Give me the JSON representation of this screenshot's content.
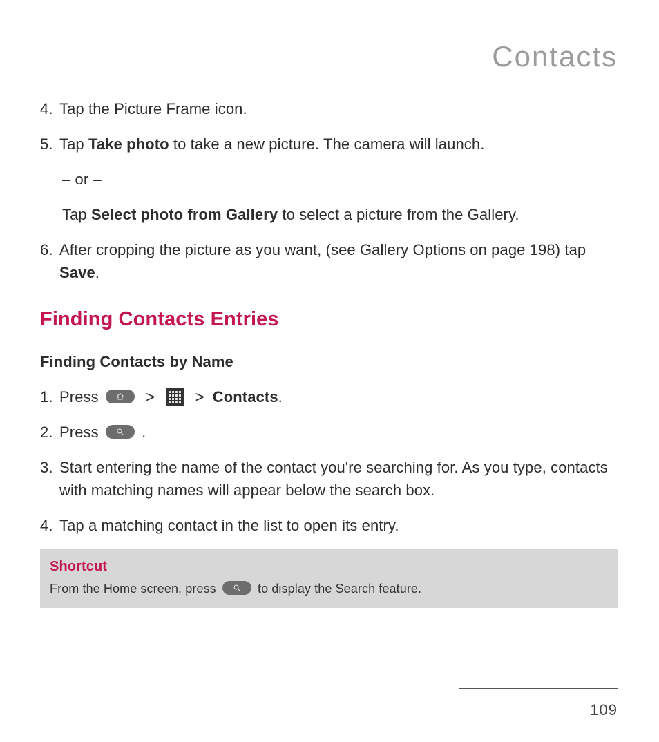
{
  "chapter_title": "Contacts",
  "steps_a": {
    "s4": {
      "num": "4.",
      "text": "Tap the Picture Frame icon."
    },
    "s5": {
      "num": "5.",
      "pre": "Tap ",
      "bold1": "Take photo",
      "post1": " to take a new picture. The camera will launch.",
      "or": "– or –",
      "pre2": "Tap ",
      "bold2": "Select photo from Gallery",
      "post2": " to select a picture from the Gallery."
    },
    "s6": {
      "num": "6.",
      "pre": " After cropping the picture as you want, (see Gallery Options on page 198) tap ",
      "bold": "Save",
      "post": "."
    }
  },
  "section_heading": "Finding Contacts Entries",
  "sub_heading": "Finding Contacts by Name",
  "steps_b": {
    "s1": {
      "num": "1.",
      "pre": "Press ",
      "sep1": ">",
      "sep2": ">",
      "contacts": "Contacts",
      "post": "."
    },
    "s2": {
      "num": "2.",
      "pre": "Press ",
      "post": " ."
    },
    "s3": {
      "num": "3.",
      "text": "Start entering the name of the contact you're searching for. As you type, contacts with matching names will appear below the search box."
    },
    "s4": {
      "num": "4.",
      "text": "Tap a matching contact in the list to open its entry."
    }
  },
  "callout": {
    "title": "Shortcut",
    "pre": "From the Home screen, press ",
    "post": " to display the Search feature."
  },
  "page_number": "109"
}
